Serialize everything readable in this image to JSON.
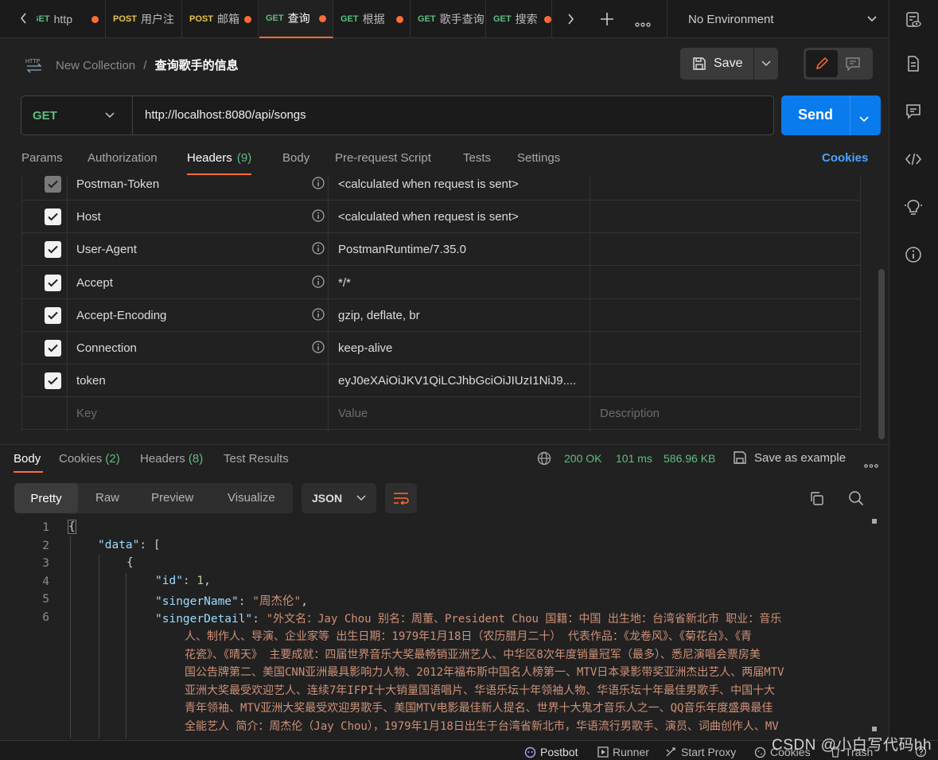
{
  "tabs": [
    {
      "method": "GET",
      "title": "http"
    },
    {
      "method": "POST",
      "title": "用户注"
    },
    {
      "method": "POST",
      "title": "邮箱"
    },
    {
      "method": "GET",
      "title": "查询"
    },
    {
      "method": "GET",
      "title": "根据"
    },
    {
      "method": "GET",
      "title": "歌手查询"
    },
    {
      "method": "GET",
      "title": "搜索"
    }
  ],
  "environment": "No Environment",
  "breadcrumb": {
    "collection": "New Collection",
    "separator": "/",
    "request": "查询歌手的信息"
  },
  "save_label": "Save",
  "request": {
    "method": "GET",
    "url": "http://localhost:8080/api/songs",
    "send_label": "Send"
  },
  "request_tabs": {
    "params": "Params",
    "authorization": "Authorization",
    "headers": "Headers",
    "headers_count": "(9)",
    "body": "Body",
    "prerequest": "Pre-request Script",
    "tests": "Tests",
    "settings": "Settings",
    "cookies": "Cookies"
  },
  "headers": [
    {
      "key": "Postman-Token",
      "value": "<calculated when request is sent>",
      "checked": true,
      "locked": true
    },
    {
      "key": "Host",
      "value": "<calculated when request is sent>",
      "checked": true
    },
    {
      "key": "User-Agent",
      "value": "PostmanRuntime/7.35.0",
      "checked": true
    },
    {
      "key": "Accept",
      "value": "*/*",
      "checked": true
    },
    {
      "key": "Accept-Encoding",
      "value": "gzip, deflate, br",
      "checked": true
    },
    {
      "key": "Connection",
      "value": "keep-alive",
      "checked": true
    },
    {
      "key": "token",
      "value": "eyJ0eXAiOiJKV1QiLCJhbGciOiJIUzI1NiJ9....",
      "checked": true
    }
  ],
  "header_placeholders": {
    "key": "Key",
    "value": "Value",
    "description": "Description"
  },
  "response": {
    "tabs": {
      "body": "Body",
      "cookies": "Cookies",
      "cookies_count": "(2)",
      "headers": "Headers",
      "headers_count": "(8)",
      "tests": "Test Results"
    },
    "status": "200 OK",
    "time": "101 ms",
    "size": "586.96 KB",
    "save_example": "Save as example",
    "formats": {
      "pretty": "Pretty",
      "raw": "Raw",
      "preview": "Preview",
      "visualize": "Visualize",
      "language": "JSON"
    }
  },
  "code_lines": [
    {
      "n": "1"
    },
    {
      "n": "2"
    },
    {
      "n": "3"
    },
    {
      "n": "4"
    },
    {
      "n": "5"
    },
    {
      "n": "6"
    }
  ],
  "code": {
    "l1": "{",
    "l2_key": "\"data\"",
    "l2_rest": ": [",
    "l3": "{",
    "l4_key": "\"id\"",
    "l4_val": "1",
    "l4_end": ",",
    "l5_key": "\"singerName\"",
    "l5_val": "\"周杰伦\"",
    "l5_end": ",",
    "l6_key": "\"singerDetail\"",
    "l6_wrap": [
      "\"外文名：Jay Chou 别名：周董、President Chou 国籍：中国 出生地：台湾省新北市 职业：音乐",
      "人、制作人、导演、企业家等 出生日期：1979年1月18日（农历腊月二十） 代表作品：《龙卷风》、《菊花台》、《青",
      "花瓷》、《晴天》 主要成就：四届世界音乐大奖最畅销亚洲艺人、中华区8次年度销量冠军（最多）、悉尼演唱会票房美",
      "国公告牌第二、美国CNN亚洲最具影响力人物、2012年福布斯中国名人榜第一、MTV日本录影带奖亚洲杰出艺人、两届MTV",
      "亚洲大奖最受欢迎艺人、连续7年IFPI十大销量国语唱片、华语乐坛十年领袖人物、华语乐坛十年最佳男歌手、中国十大",
      "青年领袖、MTV亚洲大奖最受欢迎男歌手、美国MTV电影最佳新人提名、世界十大鬼才音乐人之一、QQ音乐年度盛典最佳",
      "全能艺人 简介：周杰伦（Jay Chou），1979年1月18日出生于台湾省新北市，华语流行男歌手、演员、词曲创作人、MV"
    ]
  },
  "statusbar": {
    "postbot": "Postbot",
    "runner": "Runner",
    "proxy": "Start Proxy",
    "cookies": "Cookies",
    "trash": "Trash"
  },
  "watermark": "CSDN @小白写代码hh",
  "colors": {
    "accent": "#ff6c37",
    "send": "#097bed",
    "get": "#5fbd82",
    "post": "#e8c64a",
    "link": "#4aa3ff"
  }
}
